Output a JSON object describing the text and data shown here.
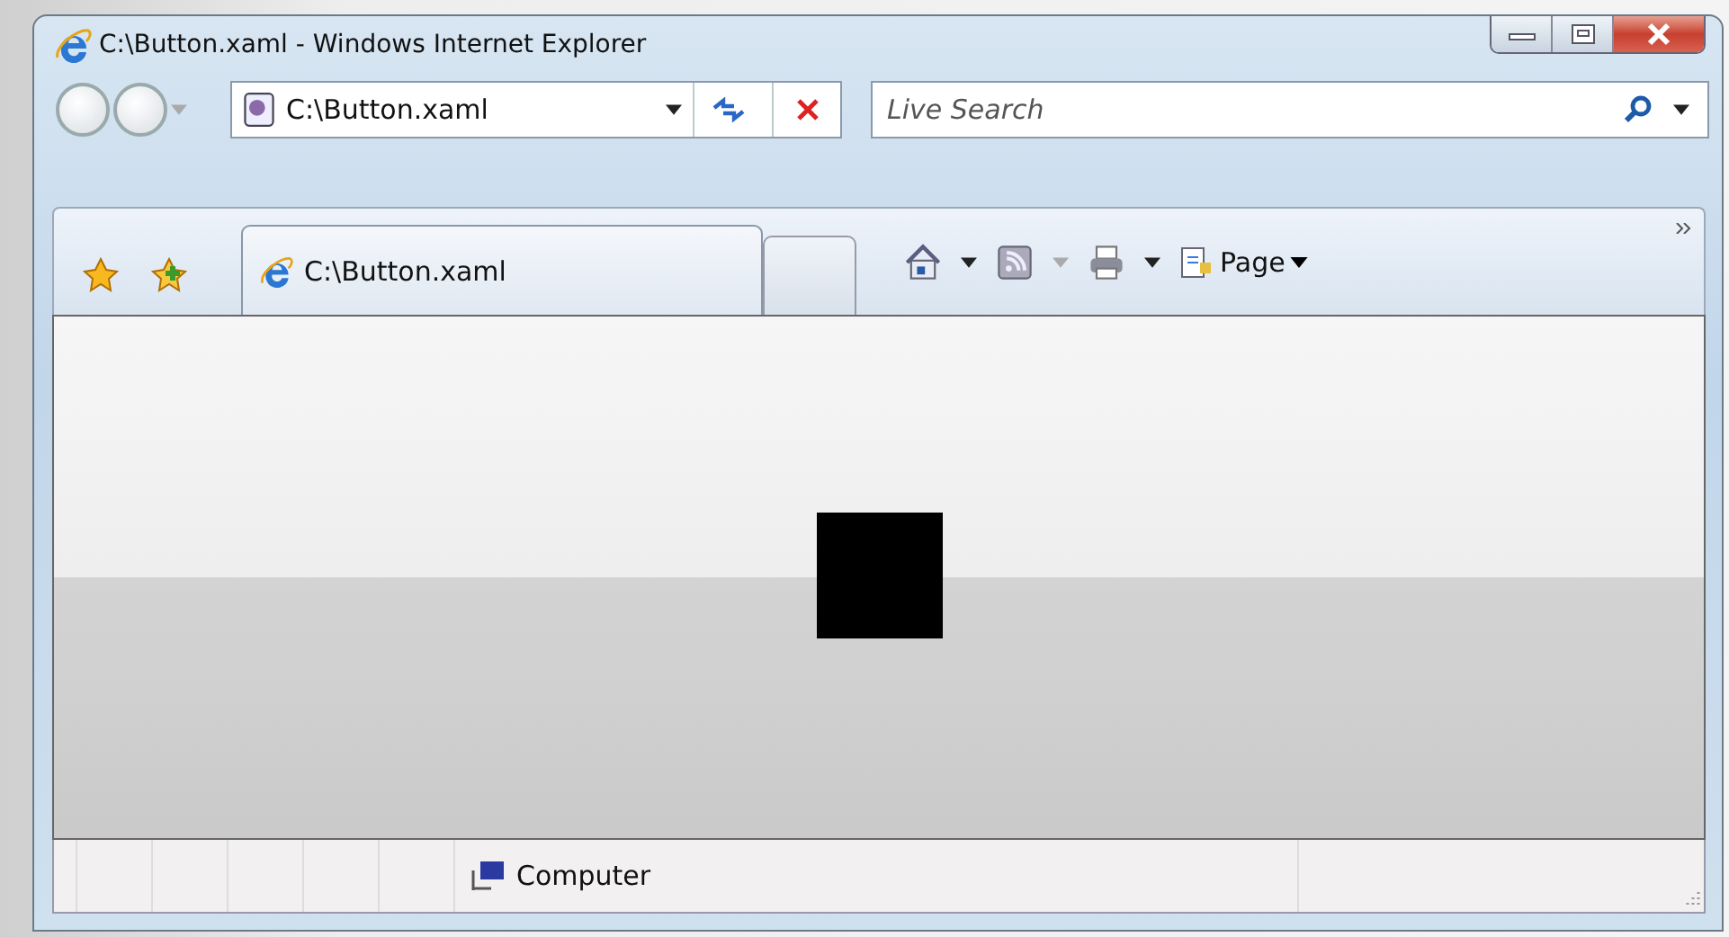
{
  "window": {
    "title": "C:\\Button.xaml - Windows Internet Explorer"
  },
  "address": {
    "value": "C:\\Button.xaml"
  },
  "search": {
    "placeholder": "Live Search"
  },
  "tabs": [
    {
      "label": "C:\\Button.xaml",
      "selected": true
    }
  ],
  "command_bar": {
    "page_label": "Page"
  },
  "status_bar": {
    "zone": "Computer"
  }
}
